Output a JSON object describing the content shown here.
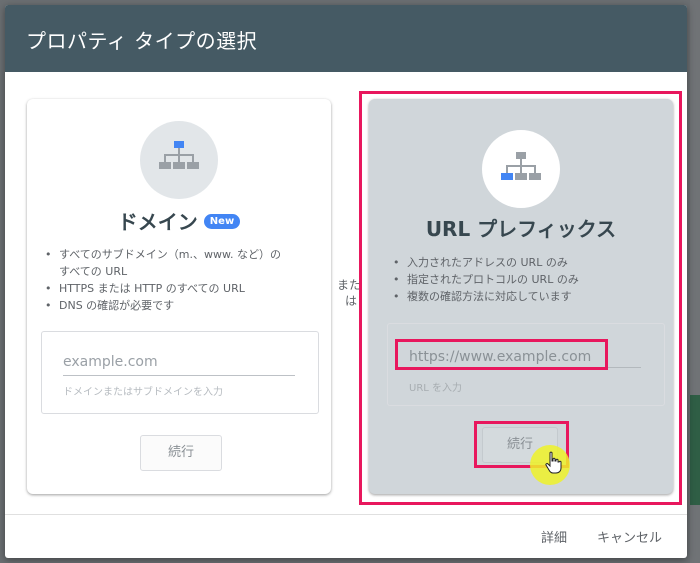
{
  "dialog": {
    "title": "プロパティ タイプの選択"
  },
  "domain_card": {
    "icon": "sitemap-icon",
    "title": "ドメイン",
    "badge": "New",
    "bullets": [
      "すべてのサブドメイン（m.、www. など）の\nすべての URL",
      "HTTPS または HTTP のすべての URL",
      "DNS の確認が必要です"
    ],
    "input_placeholder": "example.com",
    "input_helper": "ドメインまたはサブドメインを入力",
    "continue_label": "続行"
  },
  "separator": {
    "text_line1": "また",
    "text_line2": "は"
  },
  "url_card": {
    "icon": "sitemap-icon",
    "title": "URL プレフィックス",
    "bullets": [
      "入力されたアドレスの URL のみ",
      "指定されたプロトコルの URL のみ",
      "複数の確認方法に対応しています"
    ],
    "input_placeholder": "https://www.example.com",
    "input_helper": "URL を入力",
    "continue_label": "続行"
  },
  "footer": {
    "details_label": "詳細",
    "cancel_label": "キャンセル"
  },
  "colors": {
    "header": "#455a64",
    "highlight": "#e8175d",
    "accent_blue": "#4285f4",
    "selected_card": "#d0d6da",
    "cursor_halo": "#eef228"
  }
}
